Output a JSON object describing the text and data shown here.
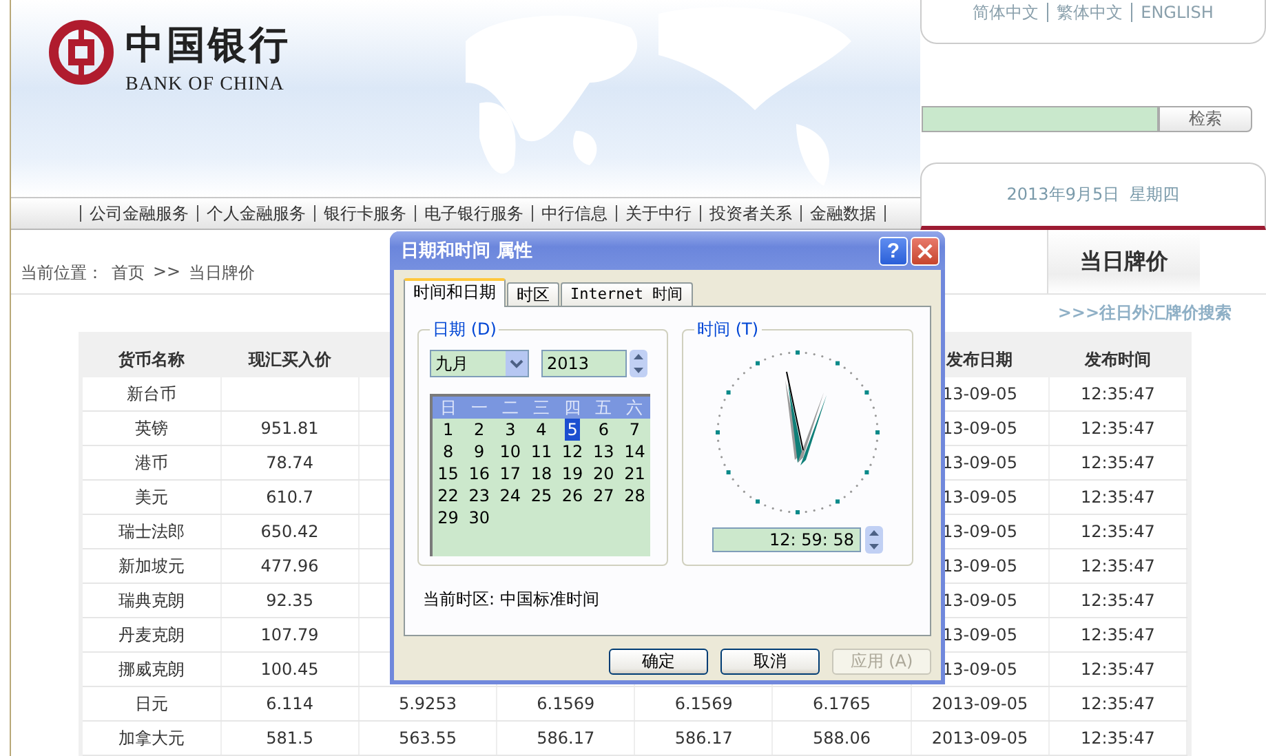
{
  "header": {
    "logo_cn": "中国银行",
    "logo_en": "BANK OF CHINA",
    "languages": [
      {
        "label": "简体中文"
      },
      {
        "label": "繁体中文"
      },
      {
        "label": "ENGLISH"
      }
    ],
    "search": {
      "button": "检索"
    },
    "date": "2013年9月5日  星期四"
  },
  "nav": [
    "公司金融服务",
    "个人金融服务",
    "银行卡服务",
    "电子银行服务",
    "中行信息",
    "关于中行",
    "投资者关系",
    "金融数据"
  ],
  "breadcrumb": {
    "label": "当前位置：",
    "links": [
      "首页",
      "当日牌价"
    ],
    "separator": ">>"
  },
  "side_tab": "当日牌价",
  "history_link": ">>>往日外汇牌价搜索",
  "table": {
    "columns": [
      "货币名称",
      "现汇买入价",
      null,
      null,
      null,
      null,
      "发布日期",
      "发布时间"
    ],
    "rows": [
      [
        "新台币",
        null,
        null,
        null,
        null,
        null,
        "13-09-05",
        "12:35:47"
      ],
      [
        "英镑",
        "951.81",
        null,
        null,
        null,
        null,
        "13-09-05",
        "12:35:47"
      ],
      [
        "港币",
        "78.74",
        null,
        null,
        null,
        null,
        "13-09-05",
        "12:35:47"
      ],
      [
        "美元",
        "610.7",
        null,
        null,
        null,
        null,
        "13-09-05",
        "12:35:47"
      ],
      [
        "瑞士法郎",
        "650.42",
        null,
        null,
        null,
        null,
        "13-09-05",
        "12:35:47"
      ],
      [
        "新加坡元",
        "477.96",
        null,
        null,
        null,
        null,
        "13-09-05",
        "12:35:47"
      ],
      [
        "瑞典克朗",
        "92.35",
        null,
        null,
        null,
        null,
        "13-09-05",
        "12:35:47"
      ],
      [
        "丹麦克朗",
        "107.79",
        null,
        null,
        null,
        null,
        "13-09-05",
        "12:35:47"
      ],
      [
        "挪威克朗",
        "100.45",
        null,
        null,
        null,
        null,
        "13-09-05",
        "12:35:47"
      ],
      [
        "日元",
        "6.114",
        "5.9253",
        "6.1569",
        "6.1569",
        "6.1765",
        "2013-09-05",
        "12:35:47"
      ],
      [
        "加拿大元",
        "581.5",
        "563.55",
        "586.17",
        "586.17",
        "588.06",
        "2013-09-05",
        "12:35:47"
      ]
    ]
  },
  "dialog": {
    "title": "日期和时间 属性",
    "help": "?",
    "tabs": [
      {
        "label": "时间和日期",
        "selected": true
      },
      {
        "label": "时区",
        "selected": false
      },
      {
        "label": "Internet 时间",
        "selected": false
      }
    ],
    "date_group": {
      "label": "日期 (D)",
      "month": "九月",
      "year": "2013",
      "weekdays": [
        "日",
        "一",
        "二",
        "三",
        "四",
        "五",
        "六"
      ],
      "days": [
        {
          "label": "1",
          "selected": false
        },
        {
          "label": "2",
          "selected": false
        },
        {
          "label": "3",
          "selected": false
        },
        {
          "label": "4",
          "selected": false
        },
        {
          "label": "5",
          "selected": true
        },
        {
          "label": "6",
          "selected": false
        },
        {
          "label": "7",
          "selected": false
        },
        {
          "label": "8",
          "selected": false
        },
        {
          "label": "9",
          "selected": false
        },
        {
          "label": "10",
          "selected": false
        },
        {
          "label": "11",
          "selected": false
        },
        {
          "label": "12",
          "selected": false
        },
        {
          "label": "13",
          "selected": false
        },
        {
          "label": "14",
          "selected": false
        },
        {
          "label": "15",
          "selected": false
        },
        {
          "label": "16",
          "selected": false
        },
        {
          "label": "17",
          "selected": false
        },
        {
          "label": "18",
          "selected": false
        },
        {
          "label": "19",
          "selected": false
        },
        {
          "label": "20",
          "selected": false
        },
        {
          "label": "21",
          "selected": false
        },
        {
          "label": "22",
          "selected": false
        },
        {
          "label": "23",
          "selected": false
        },
        {
          "label": "24",
          "selected": false
        },
        {
          "label": "25",
          "selected": false
        },
        {
          "label": "26",
          "selected": false
        },
        {
          "label": "27",
          "selected": false
        },
        {
          "label": "28",
          "selected": false
        },
        {
          "label": "29",
          "selected": false
        },
        {
          "label": "30",
          "selected": false
        }
      ]
    },
    "time_group": {
      "label": "时间 (T)",
      "time": "12: 59: 58"
    },
    "timezone": "当前时区:  中国标准时间",
    "buttons": [
      {
        "label": "确定",
        "disabled": false
      },
      {
        "label": "取消",
        "disabled": false
      },
      {
        "label": "应用 (A)",
        "disabled": true
      }
    ]
  }
}
